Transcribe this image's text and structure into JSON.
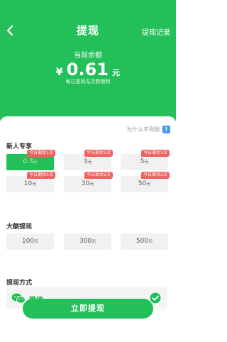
{
  "header": {
    "title": "提现",
    "record_label": "提现记录",
    "balance_label": "当前余额",
    "currency": "¥",
    "balance": "0.61",
    "unit": "元",
    "note": "每日提现无次数限制",
    "bg_color": "#23c05a"
  },
  "why_link": "为什么不到账",
  "why_badge": "!",
  "newbie": {
    "title": "新人专享",
    "options": [
      {
        "amount": "0.3",
        "unit": "元",
        "tag": "今日剩余1次",
        "selected": true
      },
      {
        "amount": "3",
        "unit": "元",
        "tag": "今日剩余1次"
      },
      {
        "amount": "5",
        "unit": "元",
        "tag": "今日剩余1次"
      },
      {
        "amount": "10",
        "unit": "元",
        "tag": "今日剩余5次"
      },
      {
        "amount": "30",
        "unit": "元",
        "tag": "今日剩余2次"
      },
      {
        "amount": "50",
        "unit": "元",
        "tag": "今日剩余2次"
      }
    ]
  },
  "large": {
    "title": "大额提现",
    "options": [
      {
        "amount": "100",
        "unit": "元"
      },
      {
        "amount": "300",
        "unit": "元"
      },
      {
        "amount": "500",
        "unit": "元"
      }
    ]
  },
  "method": {
    "title": "提现方式",
    "name": "微信",
    "icon": "wechat-icon"
  },
  "submit_label": "立即提现"
}
